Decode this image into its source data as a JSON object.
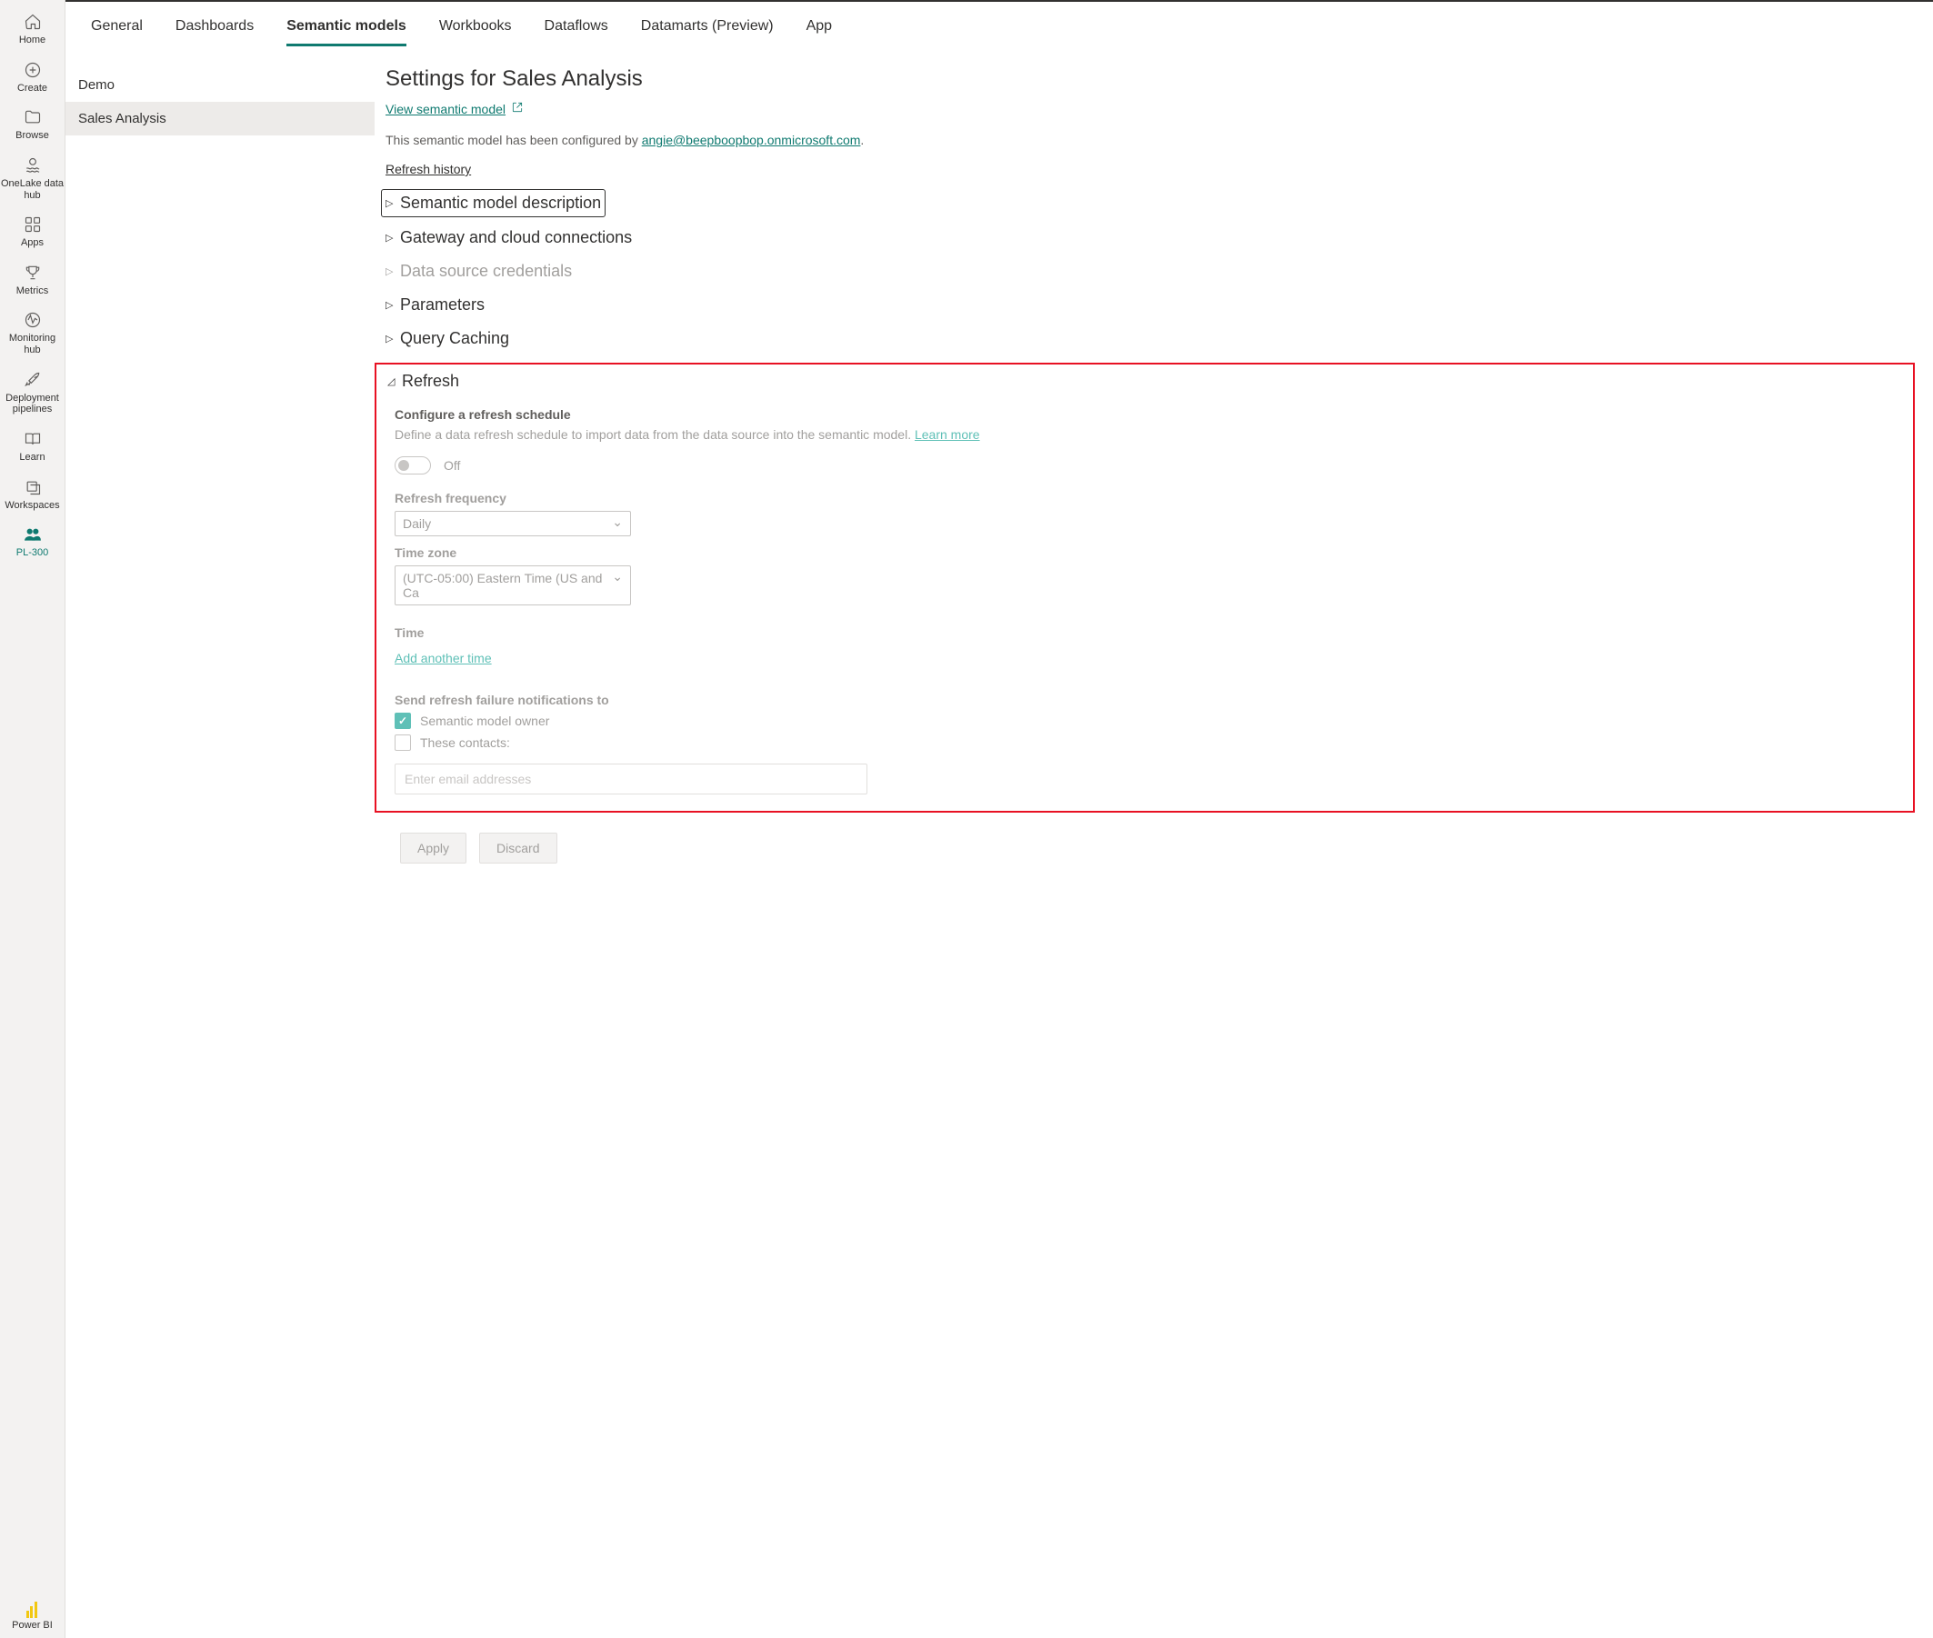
{
  "rail": {
    "items": [
      {
        "label": "Home",
        "icon": "home-icon"
      },
      {
        "label": "Create",
        "icon": "plus-circle-icon"
      },
      {
        "label": "Browse",
        "icon": "folder-icon"
      },
      {
        "label": "OneLake data hub",
        "icon": "database-waves-icon"
      },
      {
        "label": "Apps",
        "icon": "apps-grid-icon"
      },
      {
        "label": "Metrics",
        "icon": "trophy-icon"
      },
      {
        "label": "Monitoring hub",
        "icon": "activity-circle-icon"
      },
      {
        "label": "Deployment pipelines",
        "icon": "rocket-icon"
      },
      {
        "label": "Learn",
        "icon": "book-open-icon"
      },
      {
        "label": "Workspaces",
        "icon": "stack-icon"
      },
      {
        "label": "PL-300",
        "icon": "people-icon",
        "active": true
      }
    ],
    "footer_label": "Power BI"
  },
  "tabs": [
    {
      "label": "General"
    },
    {
      "label": "Dashboards"
    },
    {
      "label": "Semantic models",
      "active": true
    },
    {
      "label": "Workbooks"
    },
    {
      "label": "Dataflows"
    },
    {
      "label": "Datamarts (Preview)"
    },
    {
      "label": "App"
    }
  ],
  "list": [
    {
      "label": "Demo",
      "selected": false
    },
    {
      "label": "Sales Analysis",
      "selected": true
    }
  ],
  "detail": {
    "title": "Settings for Sales Analysis",
    "view_link": "View semantic model",
    "config_prefix": "This semantic model has been configured by ",
    "config_email": "angie@beepboopbop.onmicrosoft.com",
    "config_suffix": ".",
    "refresh_history": "Refresh history",
    "sections": {
      "description": "Semantic model description",
      "gateway": "Gateway and cloud connections",
      "credentials": "Data source credentials",
      "parameters": "Parameters",
      "query_caching": "Query Caching",
      "refresh": "Refresh"
    },
    "refresh_section": {
      "subtitle": "Configure a refresh schedule",
      "description_pre": "Define a data refresh schedule to import data from the data source into the semantic model.  ",
      "learn_more": "Learn more",
      "toggle_state": "Off",
      "freq_label": "Refresh frequency",
      "freq_value": "Daily",
      "tz_label": "Time zone",
      "tz_value": "(UTC-05:00) Eastern Time (US and Ca",
      "time_label": "Time",
      "add_time": "Add another time",
      "notify_label": "Send refresh failure notifications to",
      "chk_owner": "Semantic model owner",
      "chk_contacts": "These contacts:",
      "email_placeholder": "Enter email addresses"
    },
    "buttons": {
      "apply": "Apply",
      "discard": "Discard"
    }
  }
}
